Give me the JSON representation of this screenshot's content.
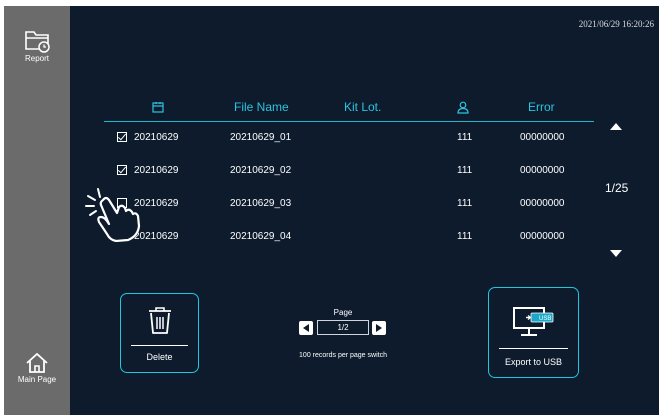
{
  "timestamp": "2021/06/29 16:20:26",
  "sidebar": {
    "report_label": "Report",
    "main_label": "Main Page"
  },
  "table": {
    "headers": {
      "date_icon": "calendar-icon",
      "file_name": "File Name",
      "kit_lot": "Kit Lot.",
      "user_icon": "user-icon",
      "error": "Error"
    },
    "rows": [
      {
        "checked": true,
        "date": "20210629",
        "file_name": "20210629_01",
        "kit_lot": "",
        "user": "111",
        "error": "00000000"
      },
      {
        "checked": true,
        "date": "20210629",
        "file_name": "20210629_02",
        "kit_lot": "",
        "user": "111",
        "error": "00000000"
      },
      {
        "checked": false,
        "date": "20210629",
        "file_name": "20210629_03",
        "kit_lot": "",
        "user": "111",
        "error": "00000000"
      },
      {
        "checked": false,
        "date": "20210629",
        "file_name": "20210629_04",
        "kit_lot": "",
        "user": "111",
        "error": "00000000"
      }
    ]
  },
  "page_indicator": "1/25",
  "delete_label": "Delete",
  "export_label": "Export to USB",
  "usb_tag": "USB",
  "pager": {
    "title": "Page",
    "value": "1/2",
    "note": "100 records per page switch"
  },
  "colors": {
    "background": "#0d1b2d",
    "sidebar": "#6b6b6b",
    "accent": "#22c6df"
  }
}
